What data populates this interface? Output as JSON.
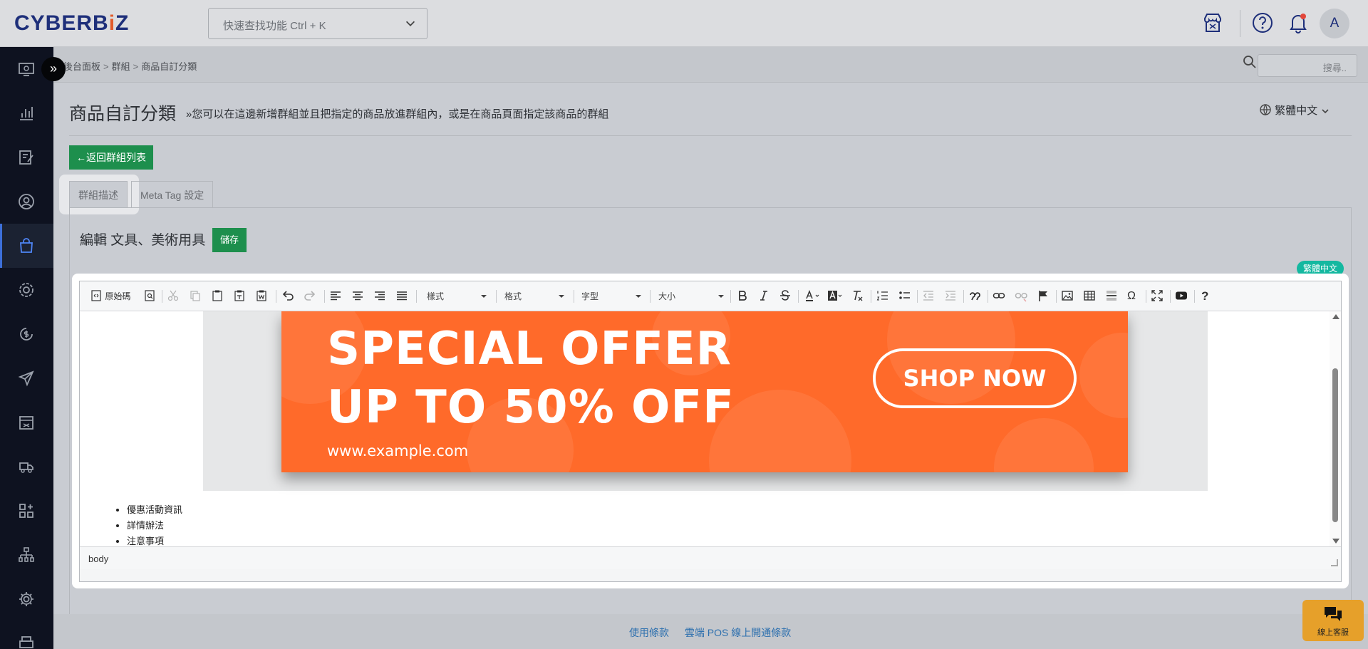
{
  "brand": {
    "logo_text_1": "CYBERB",
    "logo_dot": "i",
    "logo_text_2": "Z"
  },
  "header": {
    "quick_search_placeholder": "快速查找功能 Ctrl + K",
    "avatar_initial": "A",
    "icons": [
      "store-icon",
      "help-icon",
      "bell-icon"
    ]
  },
  "sidebar": {
    "expand_label": "»",
    "items": [
      {
        "icon": "dashboard-icon"
      },
      {
        "icon": "chart-icon"
      },
      {
        "icon": "orders-icon"
      },
      {
        "icon": "customer-icon"
      },
      {
        "icon": "shopping-bag-icon",
        "active": true
      },
      {
        "icon": "settings-gear-icon"
      },
      {
        "icon": "finance-icon"
      },
      {
        "icon": "send-icon"
      },
      {
        "icon": "store-icon"
      },
      {
        "icon": "delivery-icon"
      },
      {
        "icon": "apps-icon"
      },
      {
        "icon": "sitemap-icon"
      },
      {
        "icon": "gear-icon"
      },
      {
        "icon": "printer-icon"
      }
    ]
  },
  "breadcrumb": {
    "items": [
      "後台面板",
      "群組",
      "商品自訂分類"
    ],
    "separator": ">"
  },
  "search": {
    "placeholder": "搜尋.."
  },
  "page": {
    "title": "商品自訂分類",
    "description": "»您可以在這邊新增群組並且把指定的商品放進群組內，或是在商品頁面指定該商品的群組",
    "language": "繁體中文",
    "back_button": "返回群組列表"
  },
  "tabs": [
    {
      "label": "群組描述",
      "active": true
    },
    {
      "label": "Meta Tag 設定",
      "active": false
    }
  ],
  "editor": {
    "heading": "編輯 文具、美術用具",
    "save_button": "儲存",
    "language_badge": "繁體中文",
    "toolbar": {
      "source_label": "原始碼",
      "style_combo": "樣式",
      "format_combo": "格式",
      "font_combo": "字型",
      "size_combo": "大小"
    },
    "banner": {
      "line1": "SPECIAL OFFER",
      "line2": "UP TO 50% OFF",
      "url": "www.example.com",
      "cta": "SHOP NOW"
    },
    "bullets": [
      "優惠活動資訊",
      "詳情辦法",
      "注意事項"
    ],
    "path": "body"
  },
  "footer": {
    "links": [
      "使用條款",
      "雲端 POS 線上開通條款"
    ]
  },
  "support": {
    "label": "線上客服"
  },
  "colors": {
    "accent_green": "#1d8f4d",
    "brand_navy": "#1e2f7a",
    "banner_orange": "#ff6a2a",
    "badge_teal": "#14b8a0",
    "support_orange": "#e6a02a"
  }
}
